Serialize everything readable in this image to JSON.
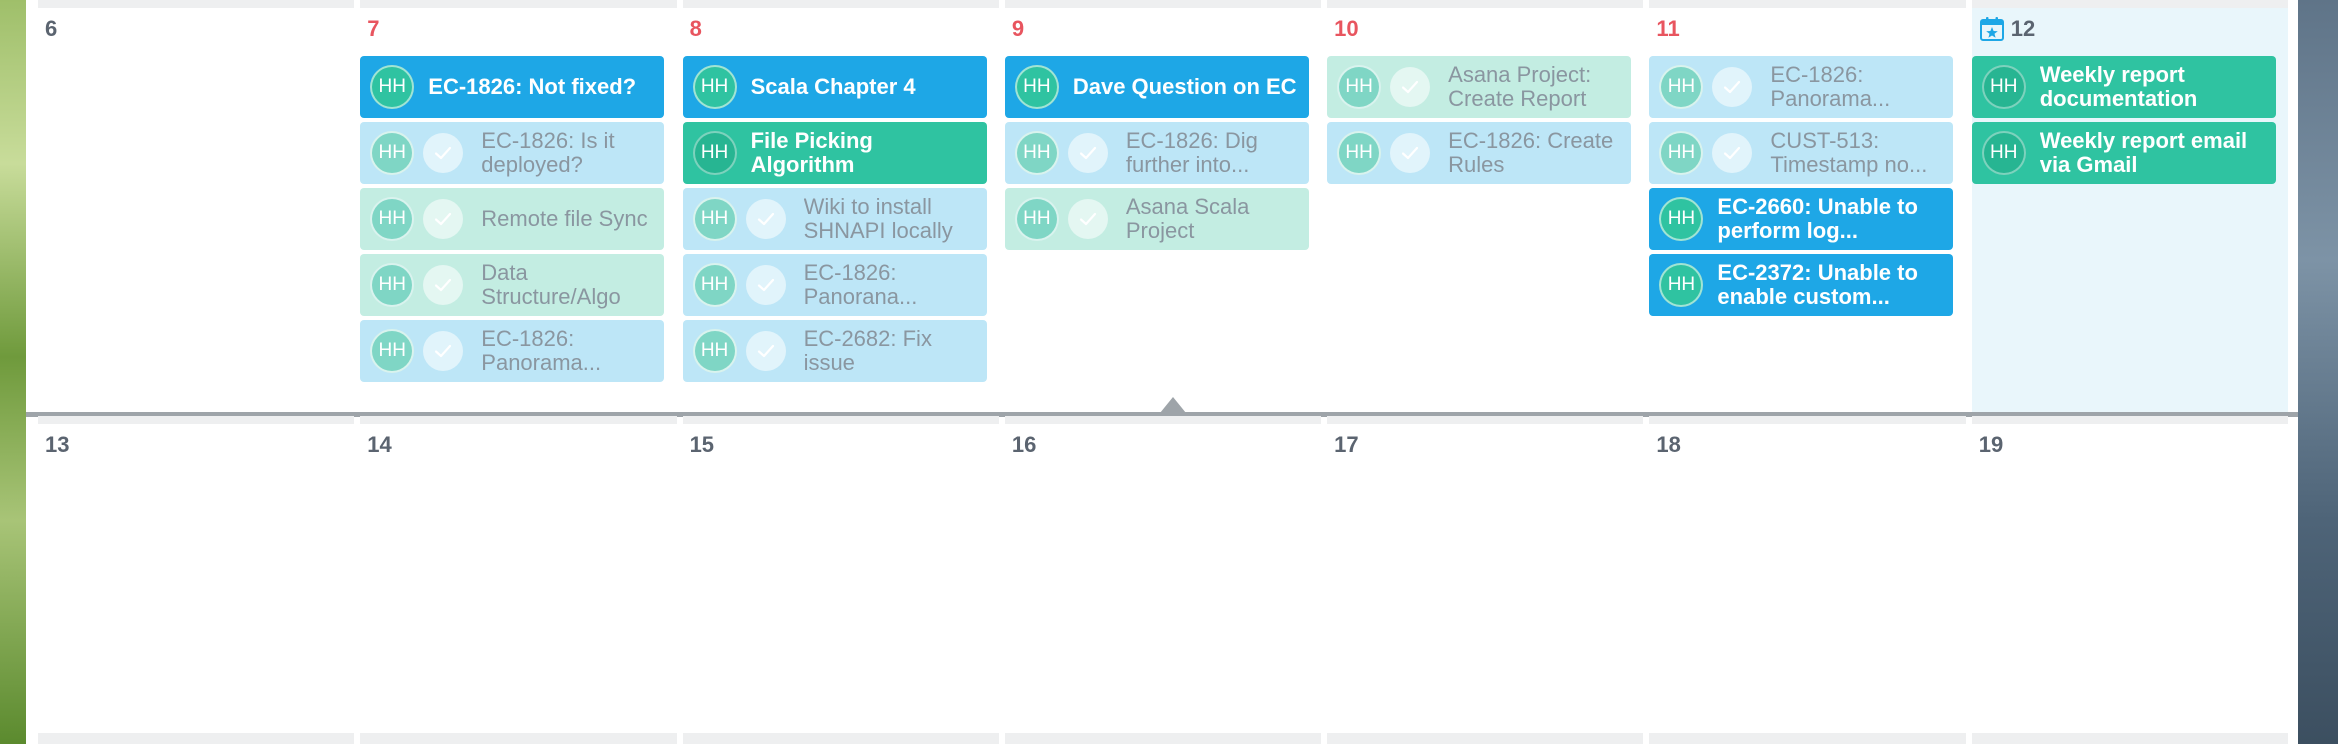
{
  "colors": {
    "active_blue": "#1ea7e6",
    "active_green": "#2fc3a1",
    "done_blue": "#bde6f7",
    "done_green": "#c3ede2",
    "weekday_number": "#e8555f",
    "today_bg": "#e9f6fb"
  },
  "icons": {
    "today": "calendar-star-icon",
    "check": "checkmark-icon"
  },
  "weeks": [
    {
      "days": [
        {
          "number": "6",
          "events": []
        },
        {
          "number": "7",
          "events": [
            {
              "initials": "HH",
              "title": "EC-1826: Not fixed?",
              "state": "active",
              "color": "blue"
            },
            {
              "initials": "HH",
              "title": "EC-1826: Is it deployed?",
              "state": "done",
              "color": "blue"
            },
            {
              "initials": "HH",
              "title": "Remote file Sync",
              "state": "done",
              "color": "green"
            },
            {
              "initials": "HH",
              "title": "Data Structure/Algo",
              "state": "done",
              "color": "green"
            },
            {
              "initials": "HH",
              "title": "EC-1826: Panorama...",
              "state": "done",
              "color": "blue"
            }
          ]
        },
        {
          "number": "8",
          "events": [
            {
              "initials": "HH",
              "title": "Scala Chapter 4",
              "state": "active",
              "color": "blue"
            },
            {
              "initials": "HH",
              "title": "File Picking Algorithm",
              "state": "active",
              "color": "green"
            },
            {
              "initials": "HH",
              "title": "Wiki to install SHNAPI locally",
              "state": "done",
              "color": "blue"
            },
            {
              "initials": "HH",
              "title": "EC-1826: Panorana...",
              "state": "done",
              "color": "blue"
            },
            {
              "initials": "HH",
              "title": "EC-2682: Fix issue",
              "state": "done",
              "color": "blue"
            }
          ]
        },
        {
          "number": "9",
          "events": [
            {
              "initials": "HH",
              "title": "Dave Question on EC",
              "state": "active",
              "color": "blue"
            },
            {
              "initials": "HH",
              "title": "EC-1826: Dig further into...",
              "state": "done",
              "color": "blue"
            },
            {
              "initials": "HH",
              "title": "Asana Scala Project",
              "state": "done",
              "color": "green"
            }
          ]
        },
        {
          "number": "10",
          "events": [
            {
              "initials": "HH",
              "title": "Asana Project: Create Report",
              "state": "done",
              "color": "green"
            },
            {
              "initials": "HH",
              "title": "EC-1826: Create Rules",
              "state": "done",
              "color": "blue"
            }
          ]
        },
        {
          "number": "11",
          "events": [
            {
              "initials": "HH",
              "title": "EC-1826: Panorama...",
              "state": "done",
              "color": "blue"
            },
            {
              "initials": "HH",
              "title": "CUST-513: Timestamp no...",
              "state": "done",
              "color": "blue"
            },
            {
              "initials": "HH",
              "title": "EC-2660: Unable to perform log...",
              "state": "active",
              "color": "blue"
            },
            {
              "initials": "HH",
              "title": "EC-2372: Unable to enable custom...",
              "state": "active",
              "color": "blue"
            }
          ]
        },
        {
          "number": "12",
          "today": true,
          "events": [
            {
              "initials": "HH",
              "title": "Weekly report documentation",
              "state": "active",
              "color": "green"
            },
            {
              "initials": "HH",
              "title": "Weekly report email via Gmail",
              "state": "active",
              "color": "green"
            }
          ]
        }
      ]
    },
    {
      "days": [
        {
          "number": "13",
          "events": []
        },
        {
          "number": "14",
          "events": []
        },
        {
          "number": "15",
          "events": []
        },
        {
          "number": "16",
          "events": []
        },
        {
          "number": "17",
          "events": []
        },
        {
          "number": "18",
          "events": []
        },
        {
          "number": "19",
          "events": []
        }
      ]
    }
  ]
}
